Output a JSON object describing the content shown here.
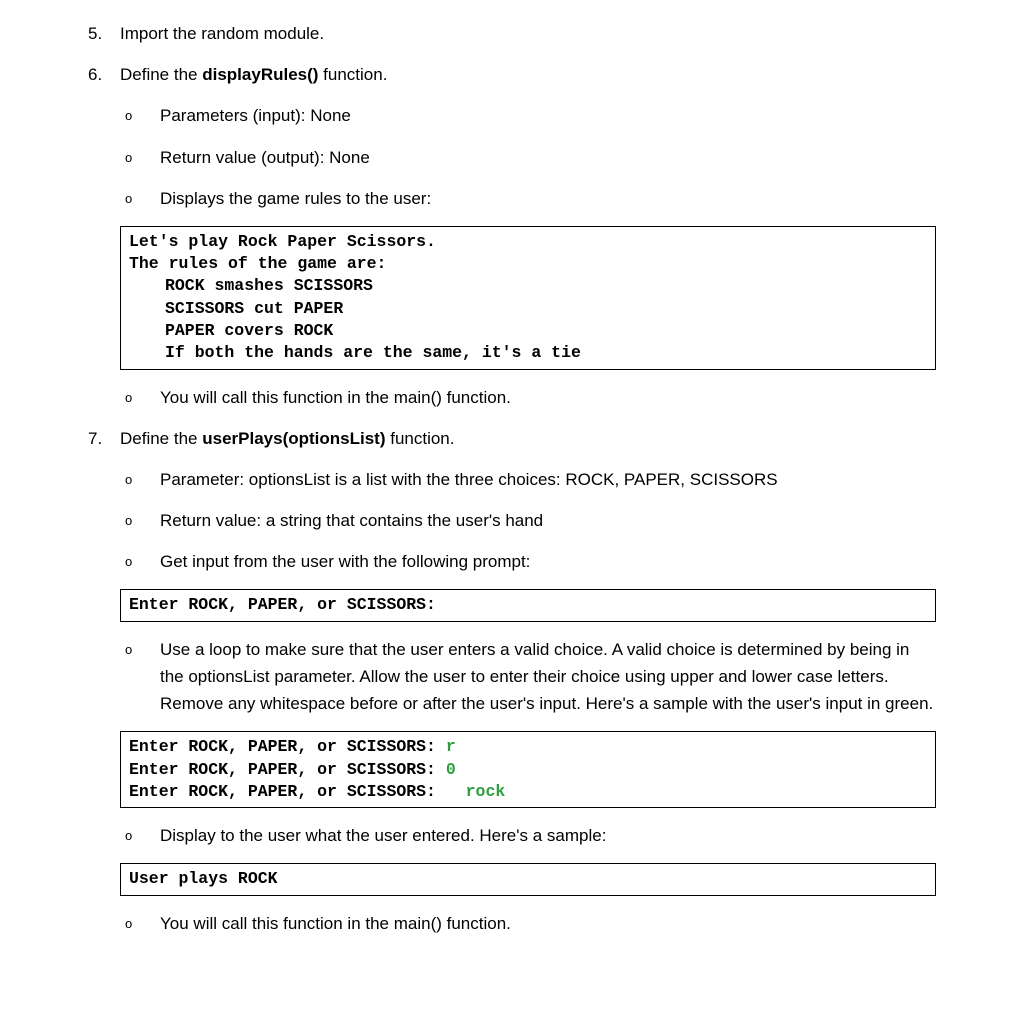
{
  "items": {
    "item5": {
      "marker": "5.",
      "text": "Import the random module."
    },
    "item6": {
      "marker": "6.",
      "prefix": "Define the ",
      "bold": "displayRules()",
      "suffix": " function.",
      "sub": {
        "a": {
          "text": "Parameters (input): None"
        },
        "b": {
          "text": "Return value (output): None"
        },
        "c": {
          "text": "Displays the game rules to the user:"
        },
        "d": {
          "text": "You will call this function in the main() function."
        }
      },
      "codebox1": {
        "l1": "Let's play Rock Paper Scissors.",
        "l2": "The rules of the game are:",
        "l3": "ROCK smashes SCISSORS",
        "l4": "SCISSORS cut PAPER",
        "l5": "PAPER covers ROCK",
        "l6": "If both the hands are the same, it's a tie"
      }
    },
    "item7": {
      "marker": "7.",
      "prefix": "Define the ",
      "bold": "userPlays(optionsList)",
      "suffix": " function.",
      "sub": {
        "a": {
          "text": "Parameter: optionsList is a list with the three choices: ROCK, PAPER, SCISSORS"
        },
        "b": {
          "text": "Return value: a string that contains the user's hand"
        },
        "c": {
          "text": "Get input from the user with the following prompt:"
        },
        "d": {
          "text": "Use a loop to make sure that the user enters a valid choice. A valid choice is determined by being in the optionsList parameter. Allow the user to enter their choice using upper and lower case letters. Remove any whitespace before or after the user's input. Here's a sample with the user's input in green."
        },
        "e": {
          "text": "Display to the user what the user entered. Here's a sample:"
        },
        "f": {
          "text": "You will call this function in the main() function."
        }
      },
      "codebox1": {
        "l1": "Enter ROCK, PAPER, or SCISSORS:"
      },
      "codebox2": {
        "prompt": "Enter ROCK, PAPER, or SCISSORS: ",
        "prompt_sp": "Enter ROCK, PAPER, or SCISSORS:   ",
        "in1": "r",
        "in2": "0",
        "in3": "rock"
      },
      "codebox3": {
        "l1": "User plays ROCK"
      }
    }
  },
  "bullet": "o"
}
